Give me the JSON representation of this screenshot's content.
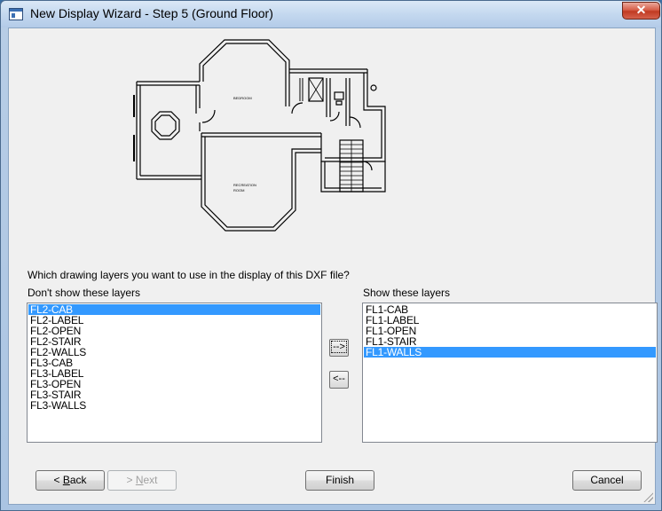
{
  "window": {
    "title": "New Display Wizard - Step 5 (Ground Floor)",
    "close_glyph": "✕"
  },
  "floorplan": {
    "labels": [
      "BEDROOM",
      "RECREATION",
      "ROOM"
    ]
  },
  "question": "Which drawing layers you want to use in the display of this DXF file?",
  "left_list": {
    "label": "Don't show these layers",
    "items": [
      "FL2-CAB",
      "FL2-LABEL",
      "FL2-OPEN",
      "FL2-STAIR",
      "FL2-WALLS",
      "FL3-CAB",
      "FL3-LABEL",
      "FL3-OPEN",
      "FL3-STAIR",
      "FL3-WALLS"
    ],
    "selected_index": 0
  },
  "right_list": {
    "label": "Show these layers",
    "items": [
      "FL1-CAB",
      "FL1-LABEL",
      "FL1-OPEN",
      "FL1-STAIR",
      "FL1-WALLS"
    ],
    "selected_index": 4
  },
  "move_buttons": {
    "add": "-->",
    "remove": "<--"
  },
  "buttons": {
    "back_prefix": "< ",
    "back_key": "B",
    "back_rest": "ack",
    "next_prefix": "> ",
    "next_key": "N",
    "next_rest": "ext",
    "finish": "Finish",
    "cancel": "Cancel"
  }
}
